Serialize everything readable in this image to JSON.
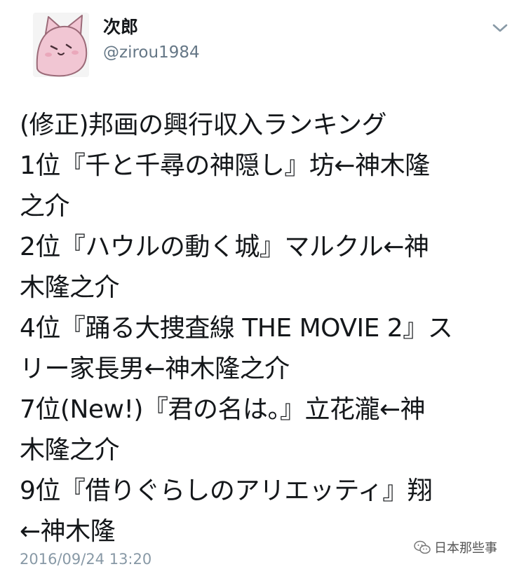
{
  "user": {
    "display_name": "次郎",
    "handle": "@zirou1984"
  },
  "tweet": {
    "lines": [
      "(修正)邦画の興行収入ランキング",
      "1位『千と千尋の神隠し』坊←神木隆",
      "之介",
      "2位『ハウルの動く城』マルクル←神",
      "木隆之介",
      "4位『踊る大捜査線 THE MOVIE 2』ス",
      "リー家長男←神木隆之介",
      "7位(New!)『君の名は。』立花瀧←神",
      "木隆之介",
      "9位『借りぐらしのアリエッティ』翔",
      "←神木隆"
    ],
    "timestamp": "2016/09/24 13:20"
  },
  "watermark": {
    "text": "日本那些事"
  },
  "icons": {
    "menu": "chevron-down-icon",
    "watermark": "wechat-icon"
  },
  "colors": {
    "primary_text": "#14171a",
    "secondary_text": "#657786",
    "timestamp": "#8899a6",
    "avatar_pink": "#f1c6d3"
  }
}
